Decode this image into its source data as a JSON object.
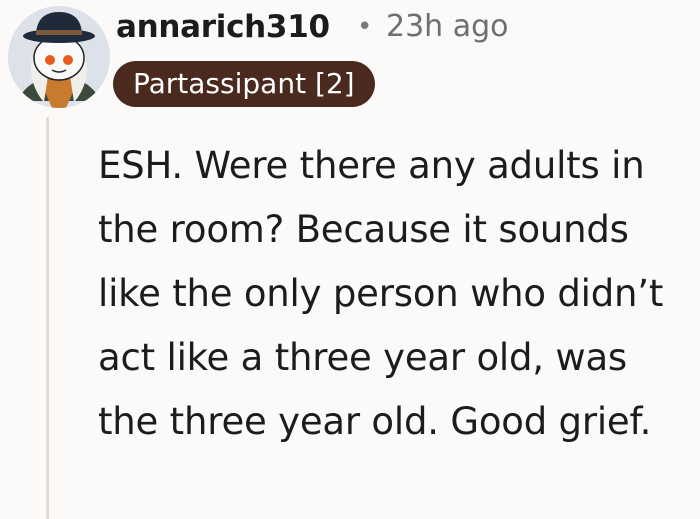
{
  "comment": {
    "username": "annarich310",
    "separator": "•",
    "timestamp": "23h ago",
    "flair": "Partassipant [2]",
    "body": "ESH. Were there any adults in the room? Because it sounds like the only person who didn’t act like a three year old, was the three year old. Good grief.",
    "avatar_icon": "snoo-avatar-icon"
  },
  "colors": {
    "flair_background": "#4a2a1e",
    "flair_text": "#ffffff",
    "thread_line": "#e8dbd5",
    "page_background": "#fbfaf8"
  }
}
